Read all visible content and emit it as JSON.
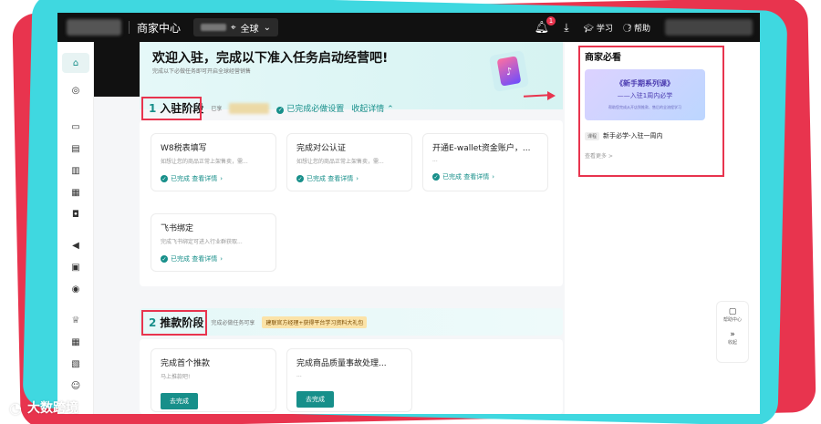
{
  "topbar": {
    "brand": "商家中心",
    "region": "全球",
    "notification_count": "1",
    "learn_label": "学习",
    "help_label": "帮助"
  },
  "banner": {
    "title": "欢迎入驻，完成以下准入任务启动经营吧!",
    "subtitle": "完成以下必做任务即可开启全球经营销售"
  },
  "stage1": {
    "number": "1",
    "title": "入驻阶段",
    "prefix": "已享",
    "completed_text": "已完成必做设置",
    "collapse_label": "收起详情",
    "tasks": [
      {
        "title": "W8税表填写",
        "desc": "如想让您的商品正常上架售卖，需...",
        "status": "已完成 查看详情"
      },
      {
        "title": "完成对公认证",
        "desc": "如想让您的商品正常上架售卖，需...",
        "status": "已完成 查看详情"
      },
      {
        "title": "开通E-wallet资金账户，...",
        "desc": "...",
        "status": "已完成 查看详情"
      },
      {
        "title": "飞书绑定",
        "desc": "完成飞书绑定可进入行业群获取...",
        "status": "已完成 查看详情"
      }
    ]
  },
  "stage2": {
    "number": "2",
    "title": "推款阶段",
    "desc": "完成必做任务可享",
    "promo": "建联官方经理+获得平台学习资料大礼包",
    "tasks": [
      {
        "title": "完成首个推款",
        "desc": "马上推款吧!",
        "button": "去完成"
      },
      {
        "title": "完成商品质量事故处理...",
        "desc": "...",
        "button": "去完成"
      }
    ]
  },
  "right_panel": {
    "title": "商家必看",
    "course_line1": "《新手期系列课》",
    "course_line2": "——入驻1周内必学",
    "course_line3": "帮助您完成从开店到推款、售后的全流程学习",
    "course_tag": "课程",
    "course_name": "新手必学-入驻一周内",
    "see_more": "查看更多 >"
  },
  "helper": {
    "help_center": "帮助中心",
    "collapse": "收起"
  },
  "watermark": {
    "text": "大数跨境"
  },
  "colors": {
    "accent": "#178f8a",
    "highlight_red": "#e8344e",
    "frame_cyan": "#3fd8e0"
  }
}
